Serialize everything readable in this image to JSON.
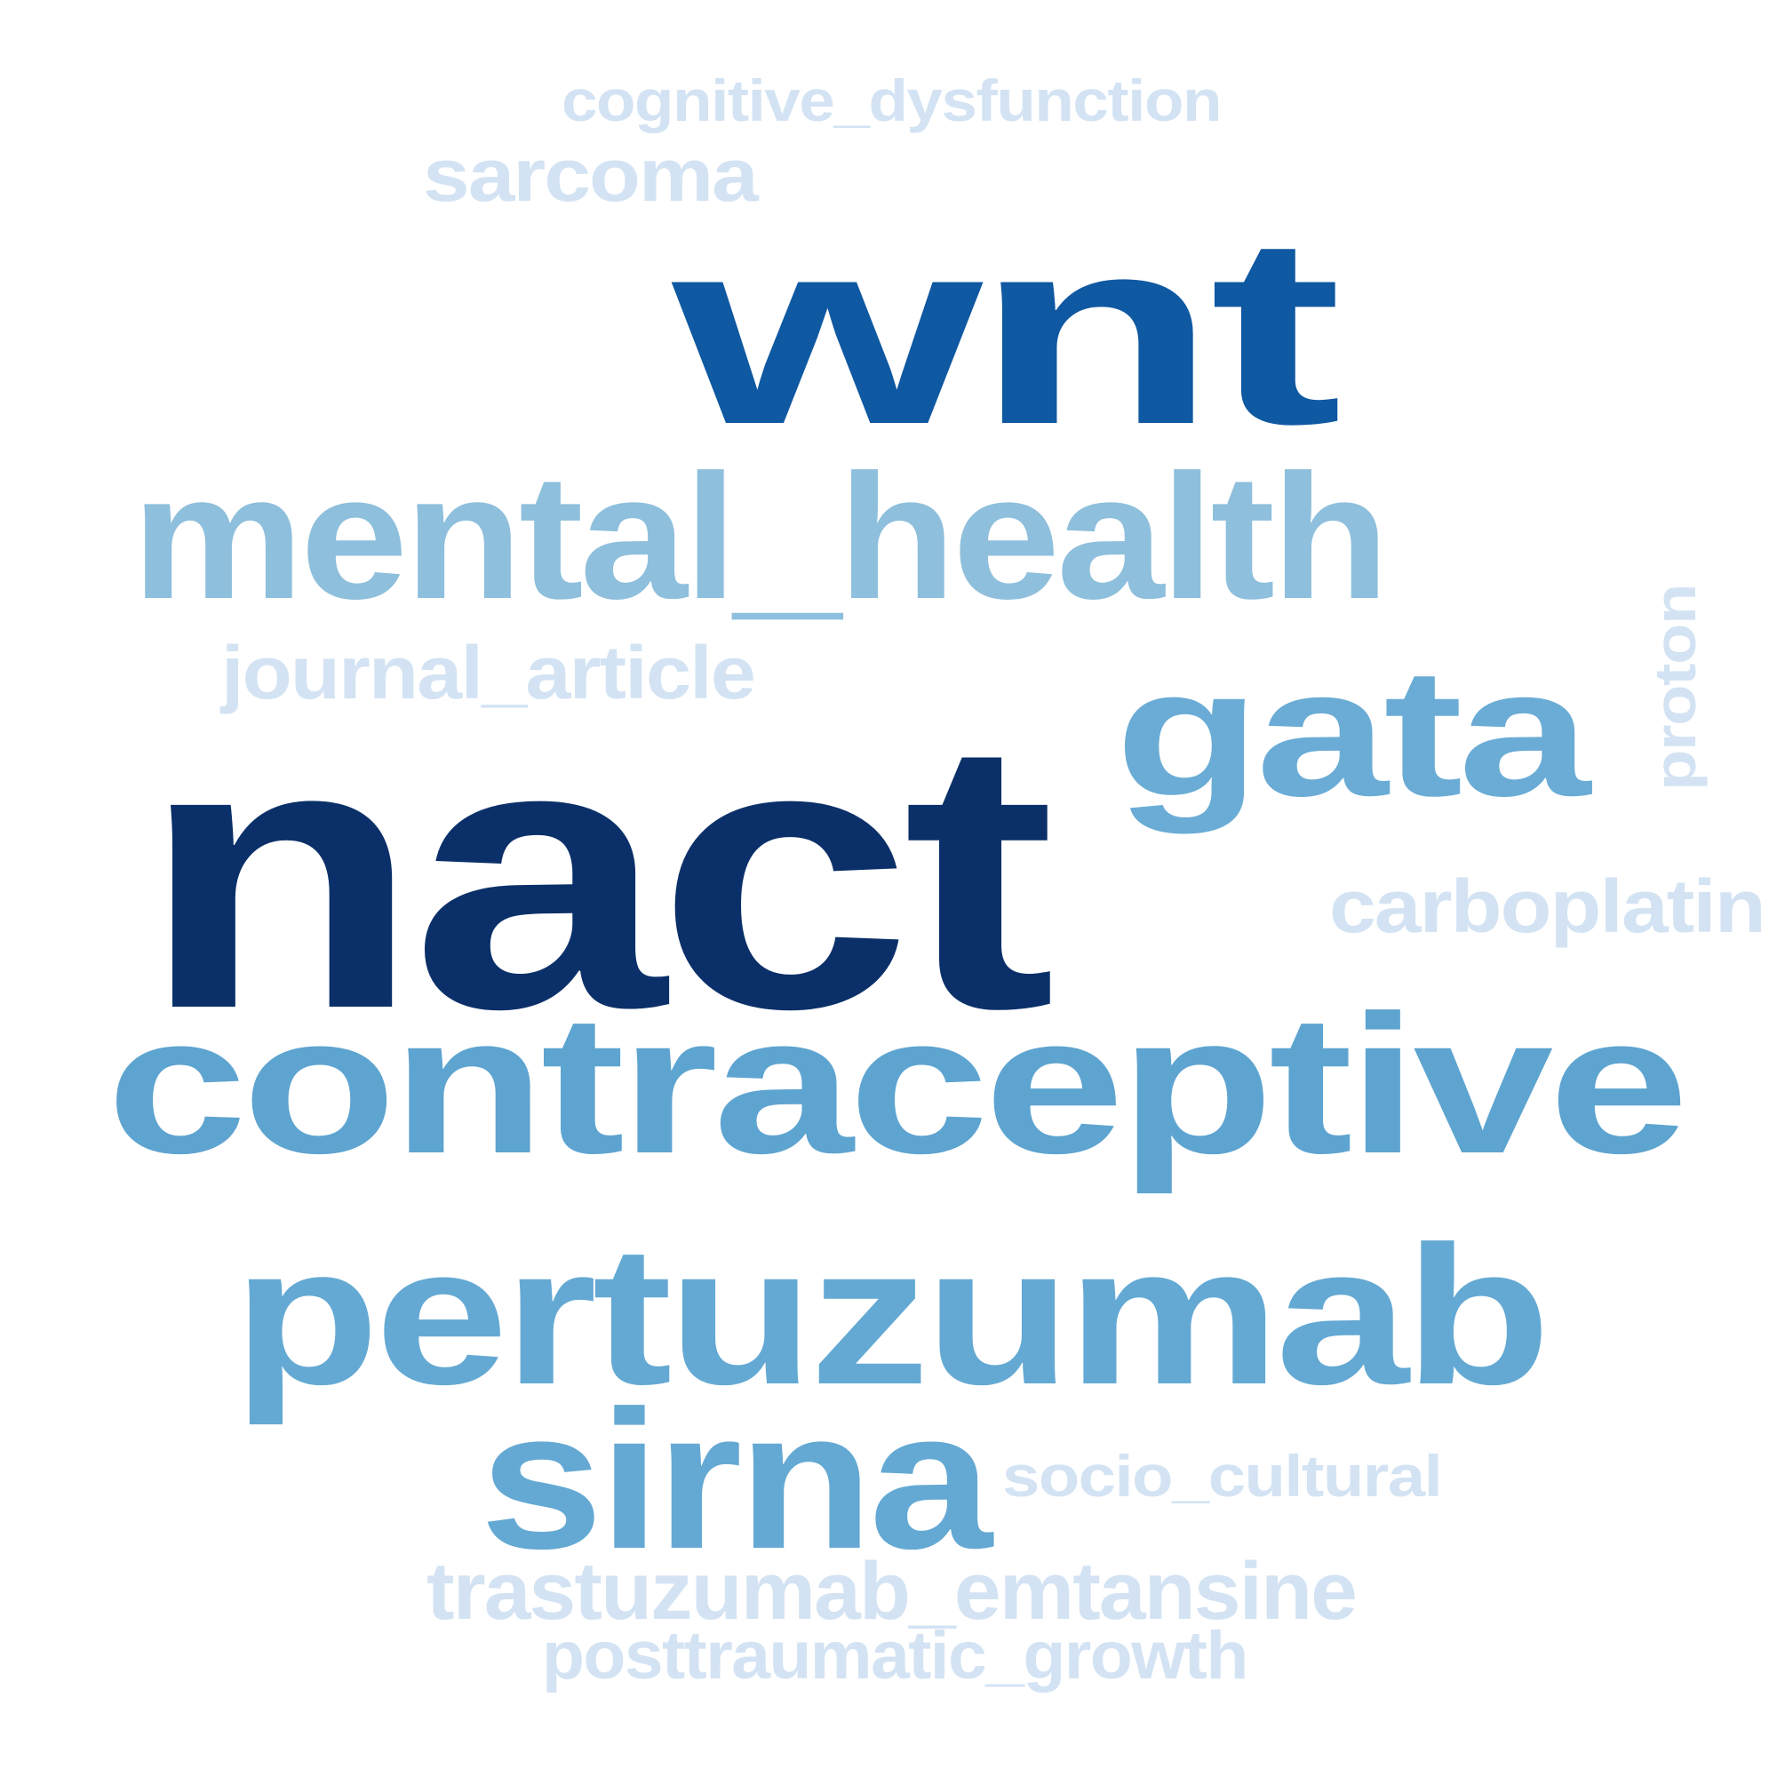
{
  "colors": {
    "darkest": "#0b3069",
    "dark": "#0f58a2",
    "medium": "#5aa2cf",
    "light": "#8ebfdc",
    "faint": "#d3e3f3",
    "background": "#ffffff"
  },
  "words": [
    {
      "text": "nact",
      "color": "#0b3069"
    },
    {
      "text": "wnt",
      "color": "#0f58a2"
    },
    {
      "text": "contraceptive",
      "color": "#5ea4d0"
    },
    {
      "text": "pertuzumab",
      "color": "#64a9d3"
    },
    {
      "text": "sirna",
      "color": "#64a9d3"
    },
    {
      "text": "gata",
      "color": "#6aacd5"
    },
    {
      "text": "mental_health",
      "color": "#8ebfdc"
    },
    {
      "text": "carboplatin",
      "color": "#d3e3f3"
    },
    {
      "text": "proton",
      "color": "#d3e3f3"
    },
    {
      "text": "journal_article",
      "color": "#d3e3f3"
    },
    {
      "text": "cognitive_dysfunction",
      "color": "#d3e3f3"
    },
    {
      "text": "sarcoma",
      "color": "#d3e3f3"
    },
    {
      "text": "socio_cultural",
      "color": "#d3e3f3"
    },
    {
      "text": "trastuzumab_emtansine",
      "color": "#d3e3f3"
    },
    {
      "text": "posttraumatic_growth",
      "color": "#d3e3f3"
    }
  ]
}
